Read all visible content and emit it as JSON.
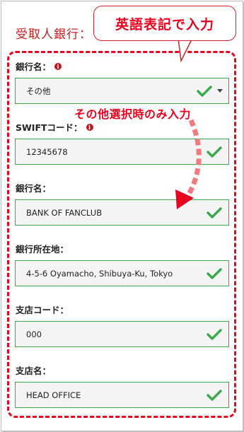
{
  "section_title": "受取人銀行：",
  "callout_text": "英語表記で入力",
  "annotation_text": "その他選択時のみ入力",
  "fields": [
    {
      "label": "銀行名：",
      "value": "その他",
      "info": true,
      "select": true
    },
    {
      "label": "SWIFTコード：",
      "value": "12345678",
      "info": true,
      "select": false
    },
    {
      "label": "銀行名：",
      "value": "BANK OF FANCLUB",
      "info": false,
      "select": false
    },
    {
      "label": "銀行所在地：",
      "value": "4-5-6 Oyamacho, Shibuya-Ku, Tokyo",
      "info": false,
      "select": false
    },
    {
      "label": "支店コード：",
      "value": "000",
      "info": false,
      "select": false
    },
    {
      "label": "支店名：",
      "value": "HEAD OFFICE",
      "info": false,
      "select": false
    }
  ],
  "icons": {
    "info": "info-icon",
    "check": "check-icon",
    "dropdown": "chevron-down-icon"
  },
  "info_glyph": "i",
  "colors": {
    "accent_red": "#e8001e",
    "title_red": "#c81e1e",
    "valid_green": "#3aa84d",
    "field_bg": "#f4f4f4"
  }
}
